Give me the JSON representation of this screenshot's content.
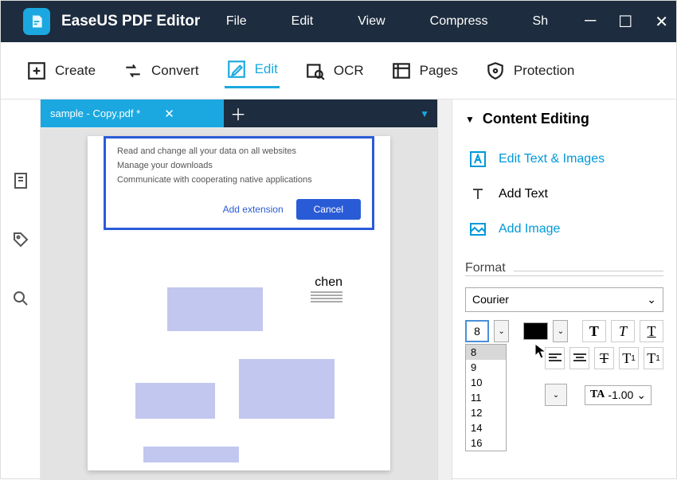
{
  "app": {
    "title": "EaseUS PDF Editor"
  },
  "menu": [
    "File",
    "Edit",
    "View",
    "Compress",
    "Sh"
  ],
  "toolbar": {
    "create": "Create",
    "convert": "Convert",
    "edit": "Edit",
    "ocr": "OCR",
    "pages": "Pages",
    "protection": "Protection"
  },
  "tabs": {
    "active_name": "sample - Copy.pdf *"
  },
  "extension_dialog": {
    "line1": "Read and change all your data on all websites",
    "line2": "Manage your downloads",
    "line3": "Communicate with cooperating native applications",
    "add": "Add extension",
    "cancel": "Cancel"
  },
  "doc": {
    "label1": "chen"
  },
  "panel": {
    "title": "Content Editing",
    "edit_text_images": "Edit Text & Images",
    "add_text": "Add Text",
    "add_image": "Add Image",
    "format_label": "Format",
    "font": "Courier",
    "size": "8",
    "size_options": [
      "8",
      "9",
      "10",
      "11",
      "12",
      "14",
      "16"
    ],
    "spacing": "-1.00"
  }
}
